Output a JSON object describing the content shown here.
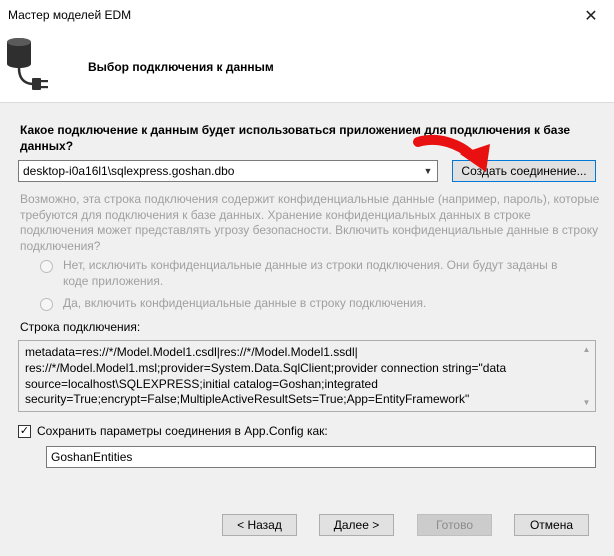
{
  "window": {
    "title": "Мастер моделей EDM",
    "close_glyph": "✕"
  },
  "header": {
    "title": "Выбор подключения к данным",
    "icon": "database-plug-icon"
  },
  "question": "Какое подключение к данным будет использоваться приложением для подключения к базе данных?",
  "connection": {
    "selected": "desktop-i0a16l1\\sqlexpress.goshan.dbo",
    "new_button_label": "Создать соединение..."
  },
  "sensitive": {
    "warning": "Возможно, эта строка подключения содержит конфиденциальные данные (например, пароль), которые требуются для подключения к базе данных. Хранение конфиденциальных данных в строке подключения может представлять угрозу безопасности. Включить конфиденциальные данные в строку подключения?",
    "option_exclude": "Нет, исключить конфиденциальные данные из строки подключения. Они будут заданы в коде приложения.",
    "option_include": "Да, включить конфиденциальные данные в строку подключения."
  },
  "connection_string": {
    "label": "Строка подключения:",
    "value": "metadata=res://*/Model.Model1.csdl|res://*/Model.Model1.ssdl|\nres://*/Model.Model1.msl;provider=System.Data.SqlClient;provider connection string=\"data\nsource=localhost\\SQLEXPRESS;initial catalog=Goshan;integrated\nsecurity=True;encrypt=False;MultipleActiveResultSets=True;App=EntityFramework\""
  },
  "save_config": {
    "checked": true,
    "label": "Сохранить параметры соединения в App.Config как:",
    "value": "GoshanEntities"
  },
  "buttons": {
    "back": "< Назад",
    "next": "Далее >",
    "finish": "Готово",
    "cancel": "Отмена"
  },
  "colors": {
    "accent": "#0078d7",
    "annotation_arrow": "#e81010",
    "disabled_text": "#a0a0a0"
  }
}
